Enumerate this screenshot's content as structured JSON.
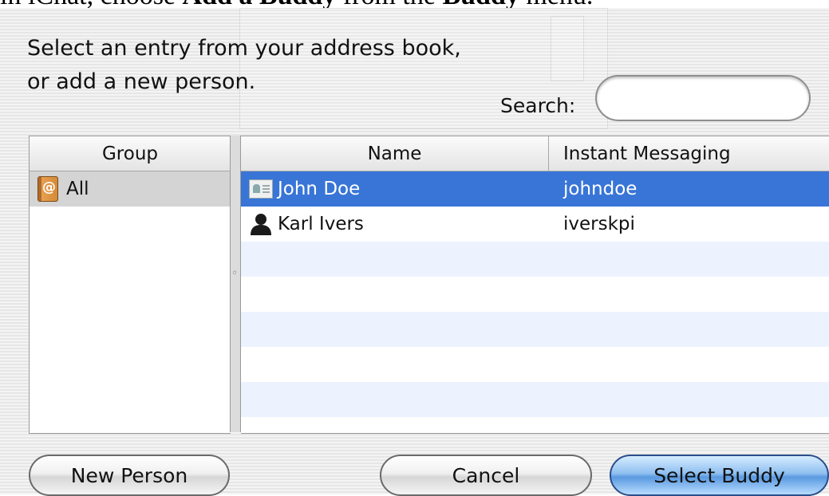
{
  "document": {
    "text_pre": "in iChat, choose ",
    "text_bold1": "Add a Buddy",
    "text_mid": " from the ",
    "text_bold2": "Buddy",
    "text_post": " menu."
  },
  "prompt": {
    "line1": "Select an entry from your address book,",
    "line2": "or add a new person."
  },
  "search": {
    "label": "Search:",
    "value": ""
  },
  "group_pane": {
    "header": "Group",
    "items": [
      {
        "label": "All",
        "icon": "address-book-icon",
        "selected": true
      }
    ]
  },
  "people_pane": {
    "columns": [
      "Name",
      "Instant Messaging"
    ],
    "rows": [
      {
        "name": "John Doe",
        "im": "johndoe",
        "icon": "contact-card-icon",
        "selected": true
      },
      {
        "name": "Karl Ivers",
        "im": "iverskpi",
        "icon": "person-silhouette-icon",
        "selected": false
      }
    ]
  },
  "buttons": {
    "new_person": "New Person",
    "cancel": "Cancel",
    "select_buddy": "Select Buddy"
  },
  "colors": {
    "selection": "#3875d7",
    "stripe": "#edf3fe",
    "default_button": "#5a9ae0"
  }
}
